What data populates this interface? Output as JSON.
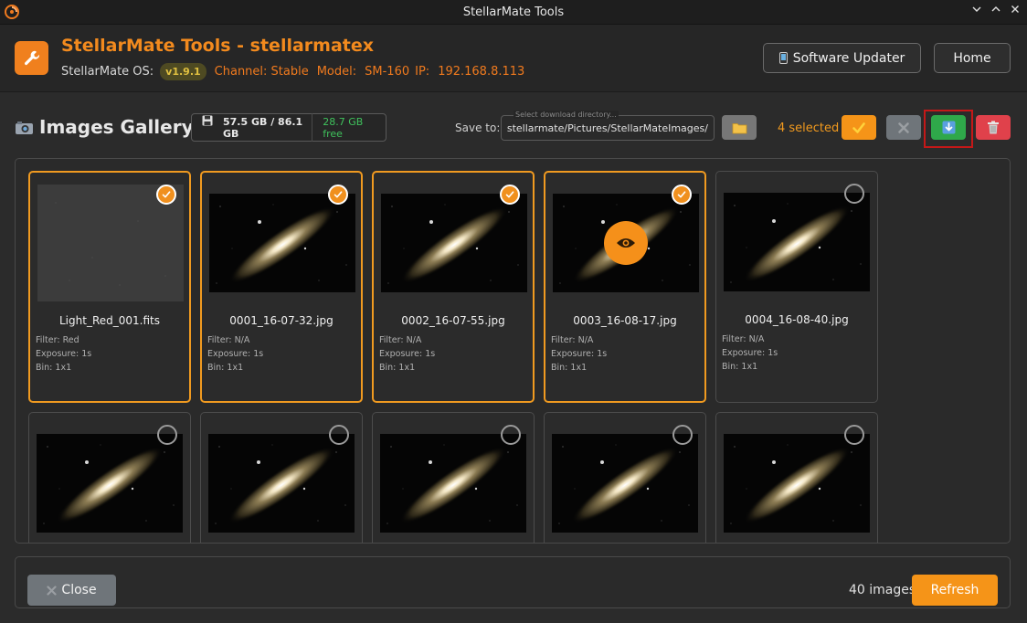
{
  "window": {
    "title": "StellarMate Tools"
  },
  "header": {
    "title": "StellarMate Tools - stellarmatex",
    "os_label": "StellarMate OS:",
    "version": "v1.9.1",
    "channel": "Channel: Stable",
    "model_label": "Model:",
    "model": "SM-160",
    "ip_label": "IP:",
    "ip": "192.168.8.113",
    "software_updater_label": "Software Updater",
    "home_label": "Home"
  },
  "toolbar": {
    "gallery_title": "Images Gallery",
    "storage_used": "57.5 GB / 86.1 GB",
    "storage_free": "28.7 GB free",
    "save_to_label": "Save to:",
    "directory_placeholder": "Select download directory...",
    "directory_value": "/home/stellarmate/Pictures/StellarMateImages",
    "selected_count": "4 selected",
    "icons": {
      "select_all": "checkmark-icon",
      "deselect": "x-icon",
      "download": "download-icon",
      "delete": "trash-icon",
      "folder": "folder-icon"
    }
  },
  "gallery": {
    "images": [
      {
        "filename": "Light_Red_001.fits",
        "filter": "Filter: Red",
        "exposure": "Exposure: 1s",
        "bin": "Bin: 1x1",
        "selected": true
      },
      {
        "filename": "0001_16-07-32.jpg",
        "filter": "Filter: N/A",
        "exposure": "Exposure: 1s",
        "bin": "Bin: 1x1",
        "selected": true
      },
      {
        "filename": "0002_16-07-55.jpg",
        "filter": "Filter: N/A",
        "exposure": "Exposure: 1s",
        "bin": "Bin: 1x1",
        "selected": true
      },
      {
        "filename": "0003_16-08-17.jpg",
        "filter": "Filter: N/A",
        "exposure": "Exposure: 1s",
        "bin": "Bin: 1x1",
        "selected": true,
        "hovered": true
      },
      {
        "filename": "0004_16-08-40.jpg",
        "filter": "Filter: N/A",
        "exposure": "Exposure: 1s",
        "bin": "Bin: 1x1",
        "selected": false
      },
      {
        "selected": false
      },
      {
        "selected": false
      },
      {
        "selected": false
      },
      {
        "selected": false
      },
      {
        "selected": false
      }
    ]
  },
  "footer": {
    "close_label": "Close",
    "image_count": "40 images",
    "refresh_label": "Refresh"
  },
  "colors": {
    "accent": "#f5901a",
    "selected_border": "#f09a20",
    "free_space": "#3fc25c",
    "download_button": "#2fa84a",
    "delete_button": "#e0414b",
    "highlight_box": "#c41818"
  }
}
